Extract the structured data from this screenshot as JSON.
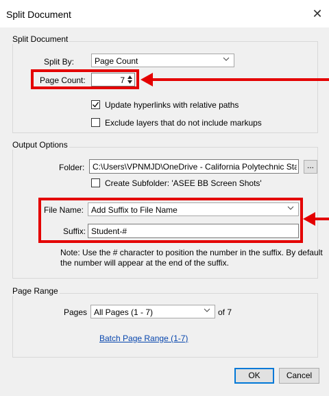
{
  "window": {
    "title": "Split Document",
    "close_glyph": "✕"
  },
  "split_document": {
    "group_title": "Split Document",
    "split_by_label": "Split By:",
    "split_by_value": "Page Count",
    "page_count_label": "Page Count:",
    "page_count_value": "7",
    "update_hyperlinks_label": "Update hyperlinks with relative paths",
    "update_hyperlinks_checked": true,
    "exclude_layers_label": "Exclude layers that do not include markups",
    "exclude_layers_checked": false
  },
  "output_options": {
    "group_title": "Output Options",
    "folder_label": "Folder:",
    "folder_value": "C:\\Users\\VPNMJD\\OneDrive - California Polytechnic Sta",
    "browse_label": "...",
    "create_subfolder_label": "Create Subfolder: 'ASEE BB Screen Shots'",
    "create_subfolder_checked": false,
    "file_name_label": "File Name:",
    "file_name_value": "Add Suffix to File Name",
    "suffix_label": "Suffix:",
    "suffix_value": "Student-#",
    "note_line1": "Note: Use the # character to position the number in the suffix. By default",
    "note_line2": "the number will appear at the end of the suffix."
  },
  "page_range": {
    "group_title": "Page Range",
    "pages_label": "Pages",
    "pages_value": "All Pages (1 - 7)",
    "of_text": "of 7",
    "batch_link": "Batch Page Range (1-7)"
  },
  "buttons": {
    "ok": "OK",
    "cancel": "Cancel"
  },
  "colors": {
    "highlight": "#e40000",
    "link": "#0645ad",
    "accent": "#0078d7"
  }
}
